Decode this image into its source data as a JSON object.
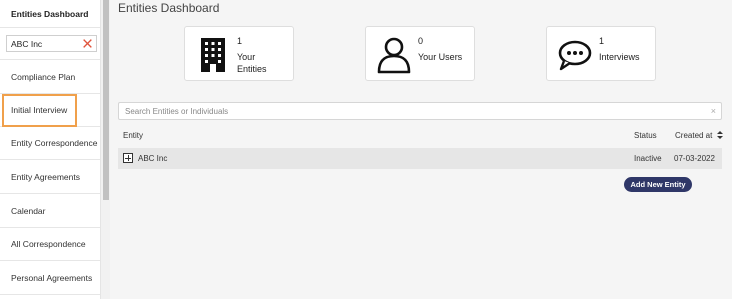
{
  "sidebar": {
    "title": "Entities Dashboard",
    "entity_search_value": "ABC Inc",
    "items": [
      {
        "label": "Compliance Plan"
      },
      {
        "label": "Initial Interview"
      },
      {
        "label": "Entity Correspondence"
      },
      {
        "label": "Entity Agreements"
      },
      {
        "label": "Calendar"
      },
      {
        "label": "All Correspondence"
      },
      {
        "label": "Personal Agreements"
      }
    ],
    "highlight_color": "#f0a04b"
  },
  "main": {
    "title": "Entities Dashboard",
    "cards": [
      {
        "count": "1",
        "label_line1": "Your",
        "label_line2": "Entities",
        "icon": "building-icon"
      },
      {
        "count": "0",
        "label_line1": "Your Users",
        "label_line2": "",
        "icon": "user-icon"
      },
      {
        "count": "1",
        "label_line1": "Interviews",
        "label_line2": "",
        "icon": "chat-bubble-icon"
      }
    ],
    "search": {
      "placeholder": "Search Entities or Individuals"
    },
    "table": {
      "headers": {
        "entity": "Entity",
        "status": "Status",
        "created": "Created at"
      },
      "rows": [
        {
          "entity": "ABC Inc",
          "status": "Inactive",
          "created": "07-03-2022"
        }
      ]
    },
    "add_button_label": "Add New Entity",
    "accent_color": "#2f3768"
  }
}
